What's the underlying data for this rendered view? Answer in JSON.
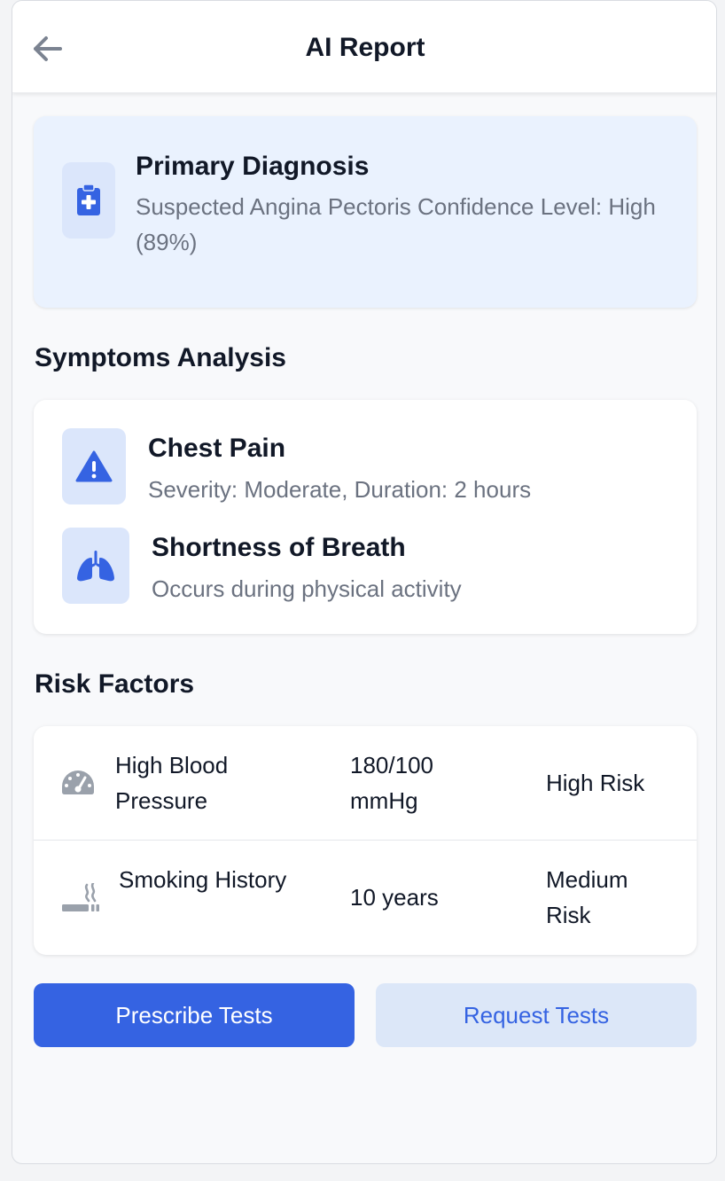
{
  "header": {
    "title": "AI Report",
    "back_icon": "arrow-left-icon"
  },
  "diagnosis": {
    "icon": "clipboard-medical-icon",
    "title": "Primary Diagnosis",
    "description": "Suspected Angina Pectoris Confidence Level: High (89%)"
  },
  "symptoms": {
    "section_title": "Symptoms Analysis",
    "items": [
      {
        "icon": "warning-icon",
        "title": "Chest Pain",
        "description": "Severity: Moderate, Duration: 2 hours"
      },
      {
        "icon": "lungs-icon",
        "title": "Shortness of Breath",
        "description": "Occurs during physical activity"
      }
    ]
  },
  "risk_factors": {
    "section_title": "Risk Factors",
    "rows": [
      {
        "icon": "gauge-icon",
        "name": "High Blood Pressure",
        "value": "180/100 mmHg",
        "level": "High Risk"
      },
      {
        "icon": "smoking-icon",
        "name": "Smoking History",
        "value": "10 years",
        "level": "Medium Risk"
      }
    ]
  },
  "actions": {
    "primary_label": "Prescribe Tests",
    "secondary_label": "Request Tests"
  },
  "colors": {
    "accent": "#3563e2",
    "diagnosis_bg": "#eaf2fe",
    "icon_bg": "#dbe6fb",
    "muted_text": "#6b7280"
  }
}
